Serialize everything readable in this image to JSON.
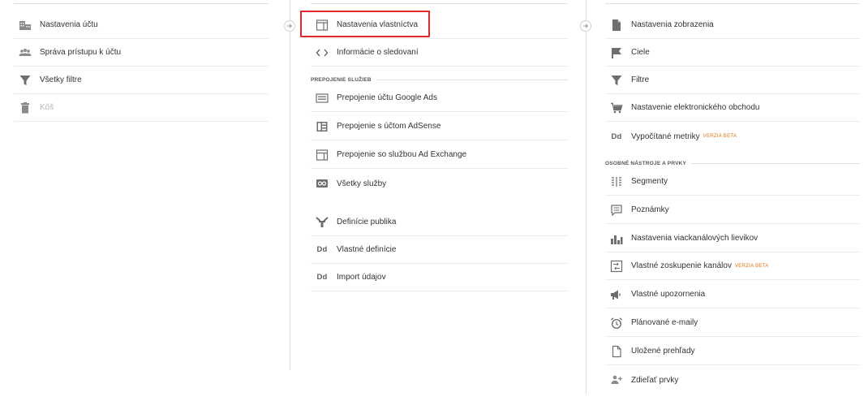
{
  "account": {
    "items": [
      {
        "label": "Nastavenia účtu",
        "icon": "building-icon"
      },
      {
        "label": "Správa prístupu k účtu",
        "icon": "users-icon"
      },
      {
        "label": "Všetky filtre",
        "icon": "filter-icon"
      },
      {
        "label": "Kôš",
        "icon": "trash-icon",
        "disabled": true
      }
    ]
  },
  "property": {
    "items": [
      {
        "label": "Nastavenia vlastníctva",
        "icon": "property-icon",
        "highlighted": true
      },
      {
        "label": "Informácie o sledovaní",
        "icon": "code-icon"
      }
    ],
    "section_title": "PREPOJENIE SLUŽIEB",
    "links": [
      {
        "label": "Prepojenie účtu Google Ads",
        "icon": "google-ads-icon"
      },
      {
        "label": "Prepojenie s účtom AdSense",
        "icon": "adsense-icon"
      },
      {
        "label": "Prepojenie so službou Ad Exchange",
        "icon": "ad-exchange-icon"
      },
      {
        "label": "Všetky služby",
        "icon": "all-products-icon"
      }
    ],
    "more": [
      {
        "label": "Definície publika",
        "icon": "audience-icon"
      },
      {
        "label": "Vlastné definície",
        "icon": "dd-icon",
        "text_icon": "Dd"
      },
      {
        "label": "Import údajov",
        "icon": "dd-icon",
        "text_icon": "Dd"
      }
    ]
  },
  "view": {
    "items": [
      {
        "label": "Nastavenia zobrazenia",
        "icon": "document-icon"
      },
      {
        "label": "Ciele",
        "icon": "flag-icon"
      },
      {
        "label": "Filtre",
        "icon": "filter-icon"
      },
      {
        "label": "Nastavenie elektronického obchodu",
        "icon": "cart-icon"
      },
      {
        "label": "Vypočítané metriky",
        "icon": "dd-icon",
        "text_icon": "Dd",
        "badge": "VERZIA BETA"
      }
    ],
    "section_title": "OSOBNÉ NÁSTROJE A PRVKY",
    "tools": [
      {
        "label": "Segmenty",
        "icon": "segments-icon"
      },
      {
        "label": "Poznámky",
        "icon": "annotations-icon"
      },
      {
        "label": "Nastavenia viackanálových lievikov",
        "icon": "bar-chart-icon"
      },
      {
        "label": "Vlastné zoskupenie kanálov",
        "icon": "channel-grouping-icon",
        "badge": "VERZIA BETA"
      },
      {
        "label": "Vlastné upozornenia",
        "icon": "megaphone-icon"
      },
      {
        "label": "Plánované e-maily",
        "icon": "alarm-clock-icon"
      },
      {
        "label": "Uložené prehľady",
        "icon": "saved-report-icon"
      },
      {
        "label": "Zdieľať prvky",
        "icon": "share-assets-icon"
      }
    ]
  },
  "colors": {
    "icon_gray": "#8a8a8a",
    "highlight_red": "#e5262b",
    "beta_orange": "#e6730a"
  }
}
